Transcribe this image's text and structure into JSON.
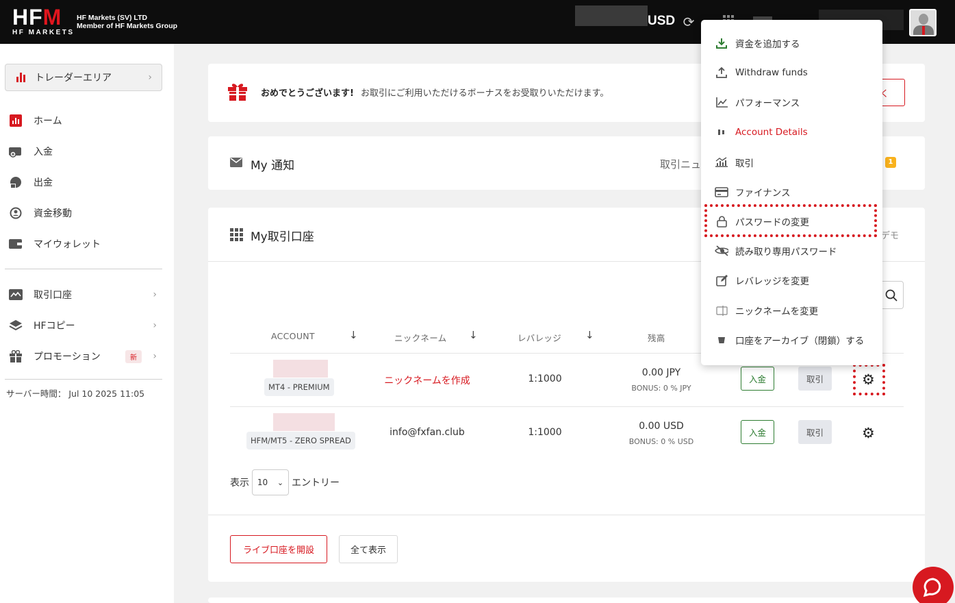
{
  "header": {
    "logo_main_letters": "HF",
    "logo_main_accent": "M",
    "logo_sub": "HF MARKETS",
    "company_line1": "HF Markets (SV) LTD",
    "company_line2": "Member of HF Markets Group",
    "currency": "USD"
  },
  "sidebar": {
    "trader_area": "トレーダーエリア",
    "items": [
      {
        "label": "ホーム",
        "icon": "chart-icon"
      },
      {
        "label": "入金",
        "icon": "deposit-icon"
      },
      {
        "label": "出金",
        "icon": "withdraw-icon"
      },
      {
        "label": "資金移動",
        "icon": "transfer-icon"
      },
      {
        "label": "マイウォレット",
        "icon": "wallet-icon"
      }
    ],
    "items2": [
      {
        "label": "取引口座",
        "icon": "accounts-icon"
      },
      {
        "label": "HFコピー",
        "icon": "layers-icon"
      },
      {
        "label": "プロモーション",
        "icon": "gift-icon",
        "badge": "新"
      }
    ],
    "server_time_label": "サーバー時間：",
    "server_time": "Jul 10 2025 11:05"
  },
  "bonus": {
    "title": "おめでとうございます!",
    "text": "お取引にご利用いただけるボーナスをお受取りいただけます。",
    "button_partial": "く"
  },
  "notifications": {
    "title": "My 通知",
    "partial_tab": "取引ニュ",
    "count": "1"
  },
  "accounts": {
    "title": "My取引口座",
    "partial_right": "デモ",
    "columns": [
      "ACCOUNT",
      "ニックネーム",
      "レバレッジ",
      "残高"
    ],
    "rows": [
      {
        "type": "MT4 - PREMIUM",
        "nickname": "ニックネームを作成",
        "leverage": "1:1000",
        "balance": "0.00 JPY",
        "bonus_label": "BONUS:",
        "bonus_value": "0 % JPY",
        "deposit": "入金",
        "trade": "取引"
      },
      {
        "type": "HFM/MT5 - ZERO SPREAD",
        "nickname": "info@fxfan.club",
        "leverage": "1:1000",
        "balance": "0.00 USD",
        "bonus_label": "BONUS:",
        "bonus_value": "0 % USD",
        "deposit": "入金",
        "trade": "取引"
      }
    ],
    "show_label": "表示",
    "page_size": "10",
    "entries_label": "エントリー",
    "open_live": "ライブ口座を開設",
    "show_all": "全て表示"
  },
  "menu": {
    "items": [
      {
        "label": "資金を追加する",
        "icon": "download-icon"
      },
      {
        "label": "Withdraw funds",
        "icon": "upload-icon"
      },
      {
        "label": "パフォーマンス",
        "icon": "line-chart-icon"
      },
      {
        "label": "Account Details",
        "icon": "details-icon"
      },
      {
        "label": "取引",
        "icon": "trade-icon"
      },
      {
        "label": "ファイナンス",
        "icon": "card-icon"
      },
      {
        "label": "パスワードの変更",
        "icon": "lock-icon"
      },
      {
        "label": "読み取り専用パスワード",
        "icon": "eye-off-icon"
      },
      {
        "label": "レバレッジを変更",
        "icon": "edit-icon"
      },
      {
        "label": "ニックネームを変更",
        "icon": "rename-icon"
      },
      {
        "label": "口座をアーカイブ（閉鎖）する",
        "icon": "archive-icon"
      }
    ]
  },
  "colors": {
    "brand_red": "#d71920",
    "header_bg": "#0d0d0d",
    "deposit_green": "#2e7d32",
    "badge_yellow": "#f9b21d"
  }
}
